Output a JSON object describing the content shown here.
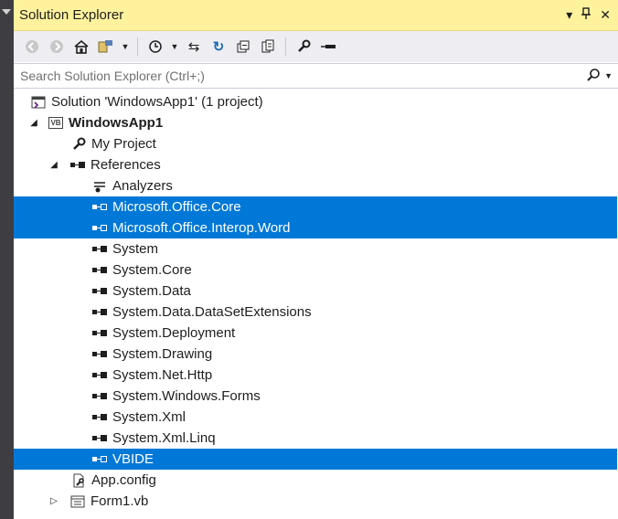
{
  "panel": {
    "title": "Solution Explorer",
    "pin_glyph": "▾",
    "dock_glyph": "ᛘ",
    "close_glyph": "✕"
  },
  "search": {
    "placeholder": "Search Solution Explorer (Ctrl+;)"
  },
  "tree": {
    "solution_label": "Solution 'WindowsApp1' (1 project)",
    "project_label": "WindowsApp1",
    "my_project_label": "My Project",
    "references_label": "References",
    "references": [
      {
        "label": "Analyzers",
        "selected": false
      },
      {
        "label": "Microsoft.Office.Core",
        "selected": true
      },
      {
        "label": "Microsoft.Office.Interop.Word",
        "selected": true
      },
      {
        "label": "System",
        "selected": false
      },
      {
        "label": "System.Core",
        "selected": false
      },
      {
        "label": "System.Data",
        "selected": false
      },
      {
        "label": "System.Data.DataSetExtensions",
        "selected": false
      },
      {
        "label": "System.Deployment",
        "selected": false
      },
      {
        "label": "System.Drawing",
        "selected": false
      },
      {
        "label": "System.Net.Http",
        "selected": false
      },
      {
        "label": "System.Windows.Forms",
        "selected": false
      },
      {
        "label": "System.Xml",
        "selected": false
      },
      {
        "label": "System.Xml.Linq",
        "selected": false
      },
      {
        "label": "VBIDE",
        "selected": true
      }
    ],
    "app_config_label": "App.config",
    "form1_label": "Form1.vb"
  },
  "colors": {
    "title_bar": "#fff29d",
    "selection": "#0078d7",
    "toolbar": "#eeeef2"
  }
}
